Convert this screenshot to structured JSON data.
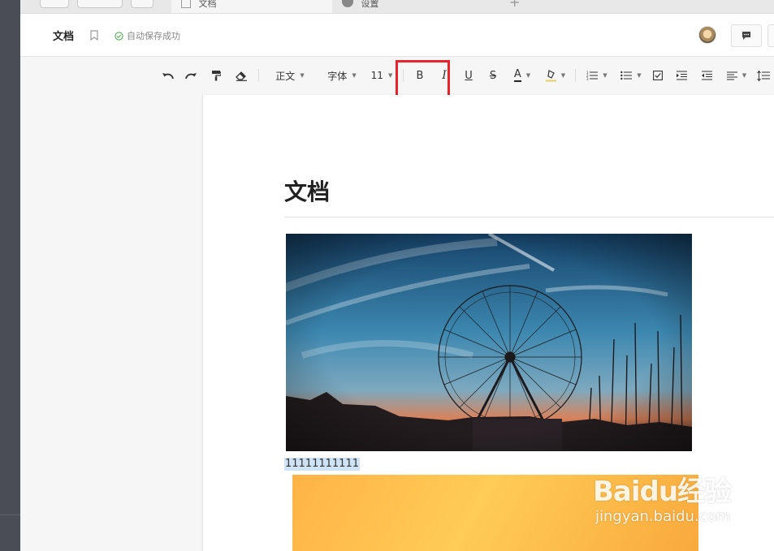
{
  "tabs": [
    {
      "label": "文档",
      "icon": "document-icon"
    },
    {
      "label": "设置",
      "icon": "settings-icon"
    }
  ],
  "header": {
    "doc_name": "文档",
    "save_status": "自动保存成功"
  },
  "toolbar": {
    "style_select": "正文",
    "font_select": "字体",
    "size_select": "11",
    "bold_label": "B",
    "italic_label": "I",
    "underline_label": "U",
    "strike_label": "S",
    "font_color_label": "A"
  },
  "document": {
    "title": "文档",
    "selected_text": "11111111111"
  },
  "watermark": {
    "logo_text": "Baidu经验",
    "url": "jingyan.baidu.com"
  },
  "colors": {
    "highlight_border": "#e8232a",
    "selection": "#cfe3f7",
    "saved_check": "#4caf50"
  }
}
